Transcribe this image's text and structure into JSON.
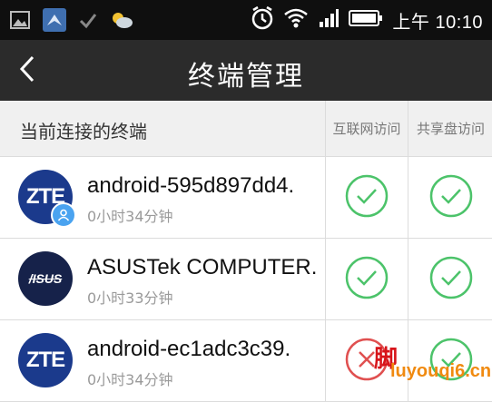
{
  "status_bar": {
    "time": "上午 10:10",
    "icons": [
      "gallery-icon",
      "bird-app-icon",
      "check-icon",
      "weather-icon",
      "alarm-icon",
      "wifi-icon",
      "signal-icon",
      "battery-icon"
    ]
  },
  "title_bar": {
    "title": "终端管理",
    "back_icon": "back-arrow-icon"
  },
  "list_header": {
    "main": "当前连接的终端",
    "col_internet": "互联网访问",
    "col_share": "共享盘访问"
  },
  "devices": [
    {
      "logo": "ZTE",
      "name": "android-595d897dd4.",
      "time": "0小时34分钟",
      "internet_access": true,
      "share_access": true,
      "has_user_badge": true
    },
    {
      "logo": "/ISUS",
      "name": "ASUSTek COMPUTER.",
      "time": "0小时33分钟",
      "internet_access": true,
      "share_access": true,
      "has_user_badge": false
    },
    {
      "logo": "ZTE",
      "name": "android-ec1adc3c39.",
      "time": "0小时34分钟",
      "internet_access": false,
      "share_access": true,
      "has_user_badge": false
    }
  ],
  "watermark": {
    "char": "脚",
    "site": "luyouqi6.cn"
  },
  "colors": {
    "status_bar": "#0f0f0f",
    "title_bar": "#2b2b2b",
    "header_bg": "#f0f0f0",
    "check_green": "#4cc36a",
    "deny_red": "#e05050",
    "zte_blue": "#1b3a8c",
    "asus_navy": "#16224a"
  }
}
